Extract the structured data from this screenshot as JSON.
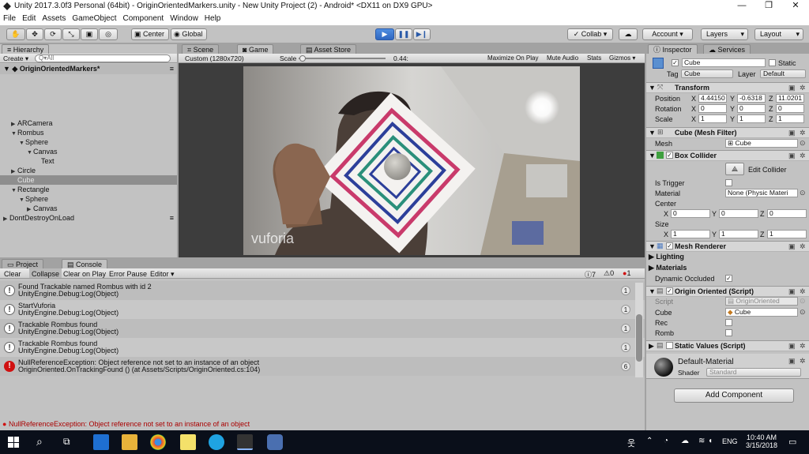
{
  "window": {
    "title": "Unity 2017.3.0f3 Personal (64bit) - OriginOrientedMarkers.unity - New Unity Project (2) - Android* <DX11 on DX9 GPU>",
    "min": "—",
    "max": "❐",
    "close": "✕"
  },
  "menu": [
    "File",
    "Edit",
    "Assets",
    "GameObject",
    "Component",
    "Window",
    "Help"
  ],
  "toolbar": {
    "center": "Center",
    "global": "Global",
    "collab": "Collab ▾",
    "account": "Account ▾",
    "layers": "Layers",
    "layout": "Layout"
  },
  "hierarchy": {
    "tab": "Hierarchy",
    "create": "Create ▾",
    "search_placeholder": "Q▾All",
    "scene": "OriginOrientedMarkers*",
    "items": [
      {
        "label": "ARCamera",
        "depth": 1,
        "arrow": "▶"
      },
      {
        "label": "Rombus",
        "depth": 1,
        "arrow": "▼"
      },
      {
        "label": "Sphere",
        "depth": 2,
        "arrow": "▼"
      },
      {
        "label": "Canvas",
        "depth": 3,
        "arrow": "▼"
      },
      {
        "label": "Text",
        "depth": 4,
        "arrow": ""
      },
      {
        "label": "Circle",
        "depth": 1,
        "arrow": "▶"
      },
      {
        "label": "Cube",
        "depth": 1,
        "arrow": "",
        "selected": true
      },
      {
        "label": "Rectangle",
        "depth": 1,
        "arrow": "▼"
      },
      {
        "label": "Sphere",
        "depth": 2,
        "arrow": "▼"
      },
      {
        "label": "Canvas",
        "depth": 3,
        "arrow": "▶"
      },
      {
        "label": "DontDestroyOnLoad",
        "depth": 0,
        "arrow": "▶"
      }
    ]
  },
  "game": {
    "tabs": [
      "Scene",
      "Game",
      "Asset Store"
    ],
    "resolution": "Custom (1280x720)",
    "scale_label": "Scale",
    "scale_value": "0.44:",
    "maximize": "Maximize On Play",
    "mute": "Mute Audio",
    "stats": "Stats",
    "gizmos": "Gizmos ▾",
    "watermark": "vuforia"
  },
  "console": {
    "tabs": [
      "Project",
      "Console"
    ],
    "buttons": [
      "Clear",
      "Collapse",
      "Clear on Play",
      "Error Pause",
      "Editor ▾"
    ],
    "counts": {
      "info": "7",
      "warn": "0",
      "error": "1"
    },
    "rows": [
      {
        "l1": "Found Trackable named Rombus with id 2",
        "l2": "UnityEngine.Debug:Log(Object)",
        "count": "1",
        "type": "info"
      },
      {
        "l1": "StartVuforia",
        "l2": "UnityEngine.Debug:Log(Object)",
        "count": "1",
        "type": "info"
      },
      {
        "l1": "Trackable Rombus found",
        "l2": "UnityEngine.Debug:Log(Object)",
        "count": "1",
        "type": "info"
      },
      {
        "l1": "Trackable Rombus found",
        "l2": "UnityEngine.Debug:Log(Object)",
        "count": "1",
        "type": "info"
      },
      {
        "l1": "NullReferenceException: Object reference not set to an instance of an object",
        "l2": "OriginOriented.OnTrackingFound () (at Assets/Scripts/OriginOriented.cs:104)",
        "count": "6",
        "type": "error"
      }
    ]
  },
  "statusbar": "NullReferenceException: Object reference not set to an instance of an object",
  "inspector": {
    "tabs": [
      "Inspector",
      "Services"
    ],
    "name": "Cube",
    "static": "Static",
    "tag_label": "Tag",
    "tag": "Cube",
    "layer_label": "Layer",
    "layer": "Default",
    "transform": {
      "title": "Transform",
      "position_label": "Position",
      "rotation_label": "Rotation",
      "scale_label": "Scale",
      "position": [
        "4.44150",
        "-0.6318",
        "11.0201"
      ],
      "rotation": [
        "0",
        "0",
        "0"
      ],
      "scale": [
        "1",
        "1",
        "1"
      ]
    },
    "mesh_filter": {
      "title": "Cube (Mesh Filter)",
      "mesh_label": "Mesh",
      "mesh": "Cube"
    },
    "box_collider": {
      "title": "Box Collider",
      "edit": "Edit Collider",
      "trigger": "Is Trigger",
      "material_label": "Material",
      "material": "None (Physic Materi",
      "center_label": "Center",
      "size_label": "Size",
      "center": [
        "0",
        "0",
        "0"
      ],
      "size": [
        "1",
        "1",
        "1"
      ]
    },
    "mesh_renderer": {
      "title": "Mesh Renderer",
      "lighting": "Lighting",
      "materials": "Materials",
      "dynamic": "Dynamic Occluded"
    },
    "origin_script": {
      "title": "Origin Oriented (Script)",
      "script_label": "Script",
      "script": "OriginOriented",
      "cube_label": "Cube",
      "cube": "Cube",
      "rec_label": "Rec",
      "romb_label": "Romb"
    },
    "static_values": {
      "title": "Static Values (Script)"
    },
    "material": {
      "name": "Default-Material",
      "shader_label": "Shader",
      "shader": "Standard"
    },
    "add_component": "Add Component"
  },
  "taskbar": {
    "lang": "ENG",
    "time": "10:40 AM",
    "date": "3/15/2018"
  }
}
